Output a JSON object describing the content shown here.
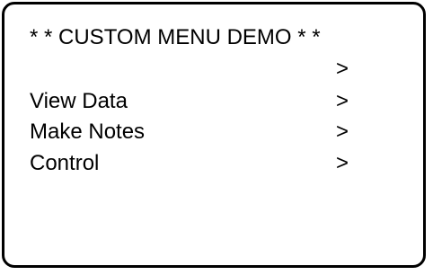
{
  "title": "* * CUSTOM MENU DEMO * *",
  "menu": {
    "items": [
      {
        "label": "",
        "arrow": ">"
      },
      {
        "label": "View Data",
        "arrow": ">"
      },
      {
        "label": "Make Notes",
        "arrow": ">"
      },
      {
        "label": "Control",
        "arrow": ">"
      }
    ]
  }
}
